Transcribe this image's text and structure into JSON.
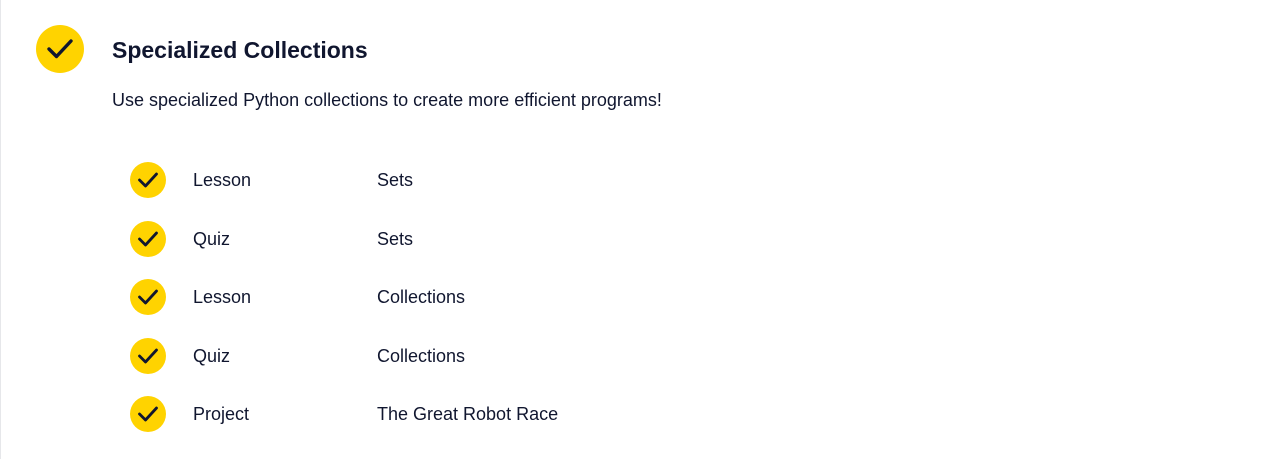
{
  "section": {
    "title": "Specialized Collections",
    "description": "Use specialized Python collections to create more efficient programs!",
    "completed": true,
    "icon": "checkmark-icon",
    "accent_color": "#ffd300",
    "text_color": "#10162f"
  },
  "items": [
    {
      "type": "Lesson",
      "name": "Sets",
      "completed": true
    },
    {
      "type": "Quiz",
      "name": "Sets",
      "completed": true
    },
    {
      "type": "Lesson",
      "name": "Collections",
      "completed": true
    },
    {
      "type": "Quiz",
      "name": "Collections",
      "completed": true
    },
    {
      "type": "Project",
      "name": "The Great Robot Race",
      "completed": true
    }
  ]
}
